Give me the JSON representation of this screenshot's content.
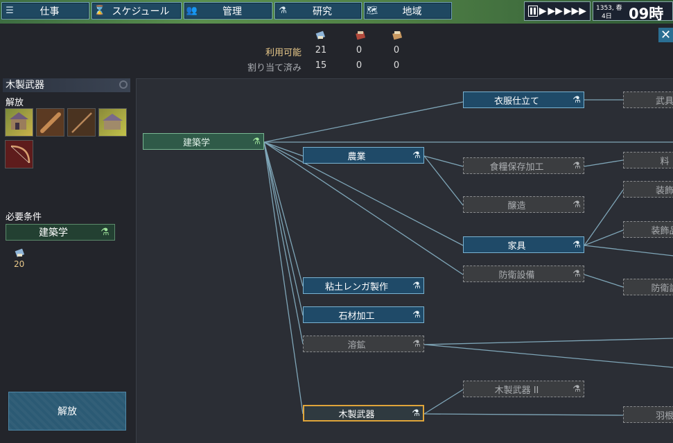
{
  "nav": [
    {
      "label": "仕事",
      "icon": "list-icon",
      "glyph": "☰"
    },
    {
      "label": "スケジュール",
      "icon": "hourglass-icon",
      "glyph": "⌛"
    },
    {
      "label": "管理",
      "icon": "people-icon",
      "glyph": "👥"
    },
    {
      "label": "研究",
      "icon": "flask-icon",
      "glyph": "⚗"
    },
    {
      "label": "地域",
      "icon": "map-icon",
      "glyph": "🗺"
    }
  ],
  "time": {
    "date_line1": "1353, 春",
    "date_line2": "4日",
    "hour": "09時"
  },
  "resources": {
    "available_label": "利用可能",
    "assigned_label": "割り当て済み",
    "columns": [
      {
        "icon": "blueprint-icon",
        "available": "21",
        "assigned": "15"
      },
      {
        "icon": "red-book-icon",
        "available": "0",
        "assigned": "0"
      },
      {
        "icon": "tan-book-icon",
        "available": "0",
        "assigned": "0"
      }
    ]
  },
  "panel": {
    "title": "木製武器",
    "unlock_label": "解放",
    "requirements_label": "必要条件",
    "requirement": "建築学",
    "cost": "20",
    "unlock_button": "解放"
  },
  "tree_nodes": [
    {
      "id": "architecture",
      "label": "建築学",
      "state": "done"
    },
    {
      "id": "tailoring",
      "label": "衣服仕立て",
      "state": "avail"
    },
    {
      "id": "weapon_r",
      "label": "武具",
      "state": "locked"
    },
    {
      "id": "farming",
      "label": "農業",
      "state": "avail"
    },
    {
      "id": "preserve",
      "label": "食糧保存加工",
      "state": "locked"
    },
    {
      "id": "cook_r",
      "label": "料",
      "state": "locked"
    },
    {
      "id": "brewing",
      "label": "醸造",
      "state": "locked"
    },
    {
      "id": "deco1",
      "label": "装飾",
      "state": "locked"
    },
    {
      "id": "furniture",
      "label": "家具",
      "state": "avail"
    },
    {
      "id": "deco2",
      "label": "装飾品",
      "state": "locked"
    },
    {
      "id": "defense",
      "label": "防衛設備",
      "state": "locked"
    },
    {
      "id": "defense_r",
      "label": "防衛設",
      "state": "locked"
    },
    {
      "id": "brick",
      "label": "粘土レンガ製作",
      "state": "avail"
    },
    {
      "id": "stone",
      "label": "石材加工",
      "state": "avail"
    },
    {
      "id": "smelting",
      "label": "溶鉱",
      "state": "locked"
    },
    {
      "id": "wood2",
      "label": "木製武器 II",
      "state": "locked"
    },
    {
      "id": "woodweapon",
      "label": "木製武器",
      "state": "selected"
    },
    {
      "id": "feather_r",
      "label": "羽根",
      "state": "locked"
    }
  ],
  "colors": {
    "accent": "#e0a53a",
    "available": "#1f4a68",
    "done": "#2f5a48",
    "link": "#7fa6b8"
  }
}
